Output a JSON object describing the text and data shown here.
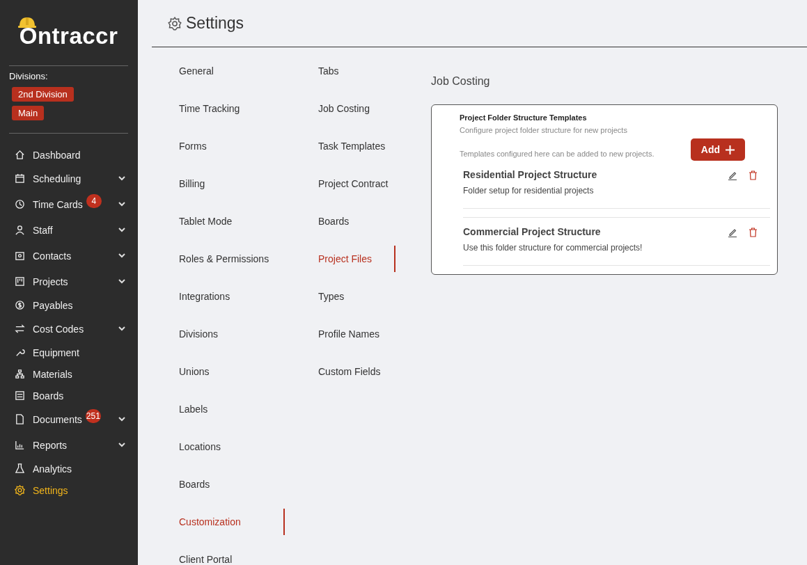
{
  "sidebar": {
    "logo": "Ontraccr",
    "divisions_label": "Divisions:",
    "divisions": [
      "2nd Division",
      "Main"
    ],
    "items": [
      {
        "label": "Dashboard",
        "selected": false,
        "expandable": false
      },
      {
        "label": "Scheduling",
        "selected": false,
        "expandable": true
      },
      {
        "label": "Time Cards",
        "selected": false,
        "expandable": true,
        "badge": "4"
      },
      {
        "label": "Staff",
        "selected": false,
        "expandable": true
      },
      {
        "label": "Contacts",
        "selected": false,
        "expandable": true
      },
      {
        "label": "Projects",
        "selected": false,
        "expandable": true
      },
      {
        "label": "Payables",
        "selected": false,
        "expandable": false
      },
      {
        "label": "Cost Codes",
        "selected": false,
        "expandable": true
      },
      {
        "label": "Equipment",
        "selected": false,
        "expandable": false
      },
      {
        "label": "Materials",
        "selected": false,
        "expandable": false
      },
      {
        "label": "Boards",
        "selected": false,
        "expandable": false
      },
      {
        "label": "Documents",
        "selected": false,
        "expandable": true,
        "badge": "251"
      },
      {
        "label": "Reports",
        "selected": false,
        "expandable": true
      },
      {
        "label": "Analytics",
        "selected": false,
        "expandable": false
      },
      {
        "label": "Settings",
        "selected": true,
        "expandable": false
      }
    ]
  },
  "header": {
    "title": "Settings"
  },
  "settings_nav": {
    "columns": [
      [
        {
          "label": "General",
          "selected": false
        },
        {
          "label": "Time Tracking",
          "selected": false
        },
        {
          "label": "Forms",
          "selected": false
        },
        {
          "label": "Billing",
          "selected": false
        },
        {
          "label": "Tablet Mode",
          "selected": false
        },
        {
          "label": "Roles & Permissions",
          "selected": false
        },
        {
          "label": "Integrations",
          "selected": false
        },
        {
          "label": "Divisions",
          "selected": false
        },
        {
          "label": "Unions",
          "selected": false
        },
        {
          "label": "Labels",
          "selected": false
        },
        {
          "label": "Locations",
          "selected": false
        },
        {
          "label": "Boards",
          "selected": false
        },
        {
          "label": "Customization",
          "selected": true
        },
        {
          "label": "Client Portal",
          "selected": false
        }
      ],
      [
        {
          "label": "Tabs",
          "selected": false
        },
        {
          "label": "Job Costing",
          "selected": false
        },
        {
          "label": "Task Templates",
          "selected": false
        },
        {
          "label": "Project Contract",
          "selected": false
        },
        {
          "label": "Boards",
          "selected": false
        },
        {
          "label": "Project Files",
          "selected": true
        },
        {
          "label": "Types",
          "selected": false
        },
        {
          "label": "Profile Names",
          "selected": false
        },
        {
          "label": "Custom Fields",
          "selected": false
        }
      ]
    ]
  },
  "content": {
    "section_title": "Job Costing",
    "card": {
      "title": "Project Folder Structure Templates",
      "subtitle": "Configure project folder structure for new projects",
      "note": "Templates configured here can be added to new projects.",
      "add_button": "Add",
      "templates": [
        {
          "name": "Residential Project Structure",
          "description": "Folder setup for residential projects"
        },
        {
          "name": "Commercial Project Structure",
          "description": "Use this folder structure for commercial projects!"
        }
      ]
    }
  }
}
